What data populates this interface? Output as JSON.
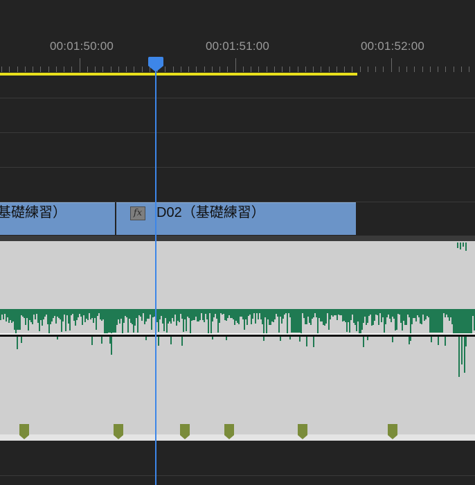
{
  "ruler": {
    "timecodes": [
      "00:01:50:00",
      "00:01:51:00",
      "00:01:52:00"
    ]
  },
  "clips": {
    "left_label": "基礎練習）",
    "main_label": "D02（基礎練習）",
    "fx_badge": "fx"
  },
  "colors": {
    "background": "#232323",
    "clip_blue": "#6b94c8",
    "audio_bg": "#cfcfcf",
    "waveform": "#1f7a52",
    "playhead": "#3d86e8",
    "work_area": "#e8df1c",
    "marker": "#7a8c3a"
  },
  "icons": {
    "playhead": "playhead-icon",
    "marker": "marker-icon",
    "fx": "fx-icon"
  }
}
